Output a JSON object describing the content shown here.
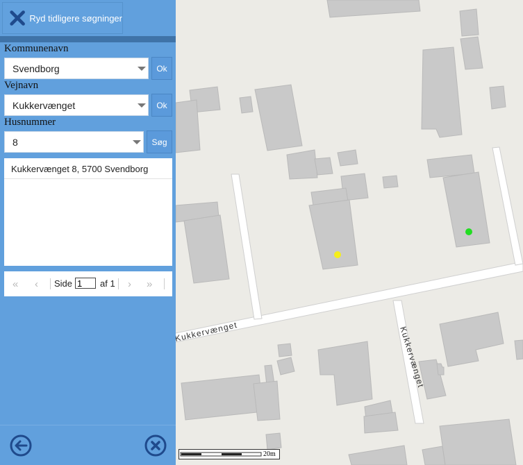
{
  "panel": {
    "clear_label": "Ryd tidligere søgninger",
    "municipality": {
      "label": "Kommunenavn",
      "value": "Svendborg",
      "ok_label": "Ok"
    },
    "street": {
      "label": "Vejnavn",
      "value": "Kukkervænget",
      "ok_label": "Ok"
    },
    "house_number": {
      "label": "Husnummer",
      "value": "8",
      "search_label": "Søg"
    },
    "results": [
      "Kukkervænget 8, 5700 Svendborg"
    ],
    "pager": {
      "page_label": "Side",
      "page_value": "1",
      "of_label": "af 1"
    },
    "icons": {
      "clear": "close-x-icon",
      "back": "arrow-left-circle-icon",
      "close": "close-circle-icon"
    }
  },
  "map": {
    "street_labels": [
      "Kukkervænget",
      "Kukkervænget"
    ],
    "scale_label": "20m",
    "markers": [
      {
        "color": "#f5ee1a"
      },
      {
        "color": "#22dd22"
      }
    ]
  },
  "colors": {
    "panel": "#61a0dd",
    "accent_dark": "#1f4a8c",
    "map_bg": "#ecebe6",
    "building": "#c9c9c9"
  }
}
